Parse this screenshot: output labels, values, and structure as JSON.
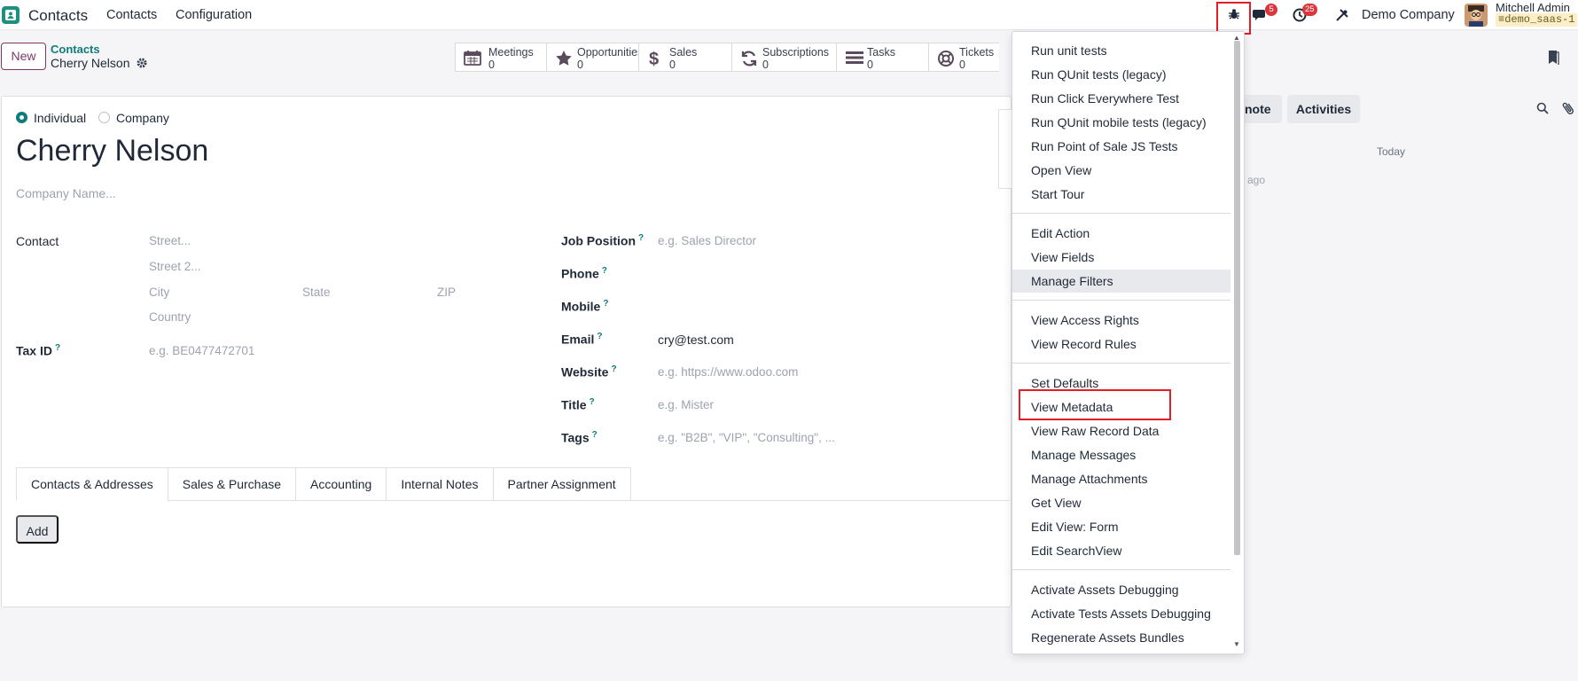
{
  "topbar": {
    "app_name": "Contacts",
    "menu_items": [
      "Contacts",
      "Configuration"
    ],
    "messages_badge": "5",
    "activities_badge": "25",
    "company": "Demo Company",
    "user": "Mitchell Admin",
    "database": "demo_saas-1"
  },
  "control": {
    "new_label": "New",
    "breadcrumb_parent": "Contacts",
    "breadcrumb_current": "Cherry Nelson"
  },
  "smart_buttons": [
    {
      "label": "Meetings",
      "value": "0",
      "icon": "calendar-icon"
    },
    {
      "label": "Opportunities",
      "value": "0",
      "icon": "star-icon"
    },
    {
      "label": "Sales",
      "value": "0",
      "icon": "dollar-icon"
    },
    {
      "label": "Subscriptions",
      "value": "0",
      "icon": "refresh-icon"
    },
    {
      "label": "Tasks",
      "value": "0",
      "icon": "tasks-icon"
    },
    {
      "label": "Tickets",
      "value": "0",
      "icon": "lifebuoy-icon"
    }
  ],
  "form": {
    "type_options": [
      "Individual",
      "Company"
    ],
    "selected_type": "Individual",
    "name": "Cherry Nelson",
    "company_placeholder": "Company Name...",
    "contact_label": "Contact",
    "street_placeholder": "Street...",
    "street2_placeholder": "Street 2...",
    "city_placeholder": "City",
    "state_placeholder": "State",
    "zip_placeholder": "ZIP",
    "country_placeholder": "Country",
    "taxid_label": "Tax ID",
    "taxid_placeholder": "e.g. BE0477472701",
    "help_mark": "?",
    "job_label": "Job Position",
    "job_placeholder": "e.g. Sales Director",
    "phone_label": "Phone",
    "mobile_label": "Mobile",
    "email_label": "Email",
    "email_value": "cry@test.com",
    "website_label": "Website",
    "website_placeholder": "e.g. https://www.odoo.com",
    "title_label": "Title",
    "title_placeholder": "e.g. Mister",
    "tags_label": "Tags",
    "tags_placeholder": "e.g. \"B2B\", \"VIP\", \"Consulting\", ...",
    "tabs": [
      "Contacts & Addresses",
      "Sales & Purchase",
      "Accounting",
      "Internal Notes",
      "Partner Assignment"
    ],
    "active_tab": "Contacts & Addresses",
    "add_label": "Add"
  },
  "chatter": {
    "note_fragment": "note",
    "activities_label": "Activities",
    "today_label": "Today",
    "ago_fragment": "ago"
  },
  "debug_menu": {
    "groups": [
      [
        "Run unit tests",
        "Run QUnit tests (legacy)",
        "Run Click Everywhere Test",
        "Run QUnit mobile tests (legacy)",
        "Run Point of Sale JS Tests",
        "Open View",
        "Start Tour"
      ],
      [
        "Edit Action",
        "View Fields",
        "Manage Filters"
      ],
      [
        "View Access Rights",
        "View Record Rules"
      ],
      [
        "Set Defaults",
        "View Metadata",
        "View Raw Record Data",
        "Manage Messages",
        "Manage Attachments",
        "Get View",
        "Edit View: Form",
        "Edit SearchView"
      ],
      [
        "Activate Assets Debugging",
        "Activate Tests Assets Debugging",
        "Regenerate Assets Bundles"
      ]
    ],
    "hovered_item": "Manage Filters",
    "highlighted_item": "View Metadata"
  },
  "colors": {
    "accent": "#0f7c7c",
    "brand": "#7c3a63",
    "highlight": "#e11d26",
    "badge": "#d9363e"
  }
}
